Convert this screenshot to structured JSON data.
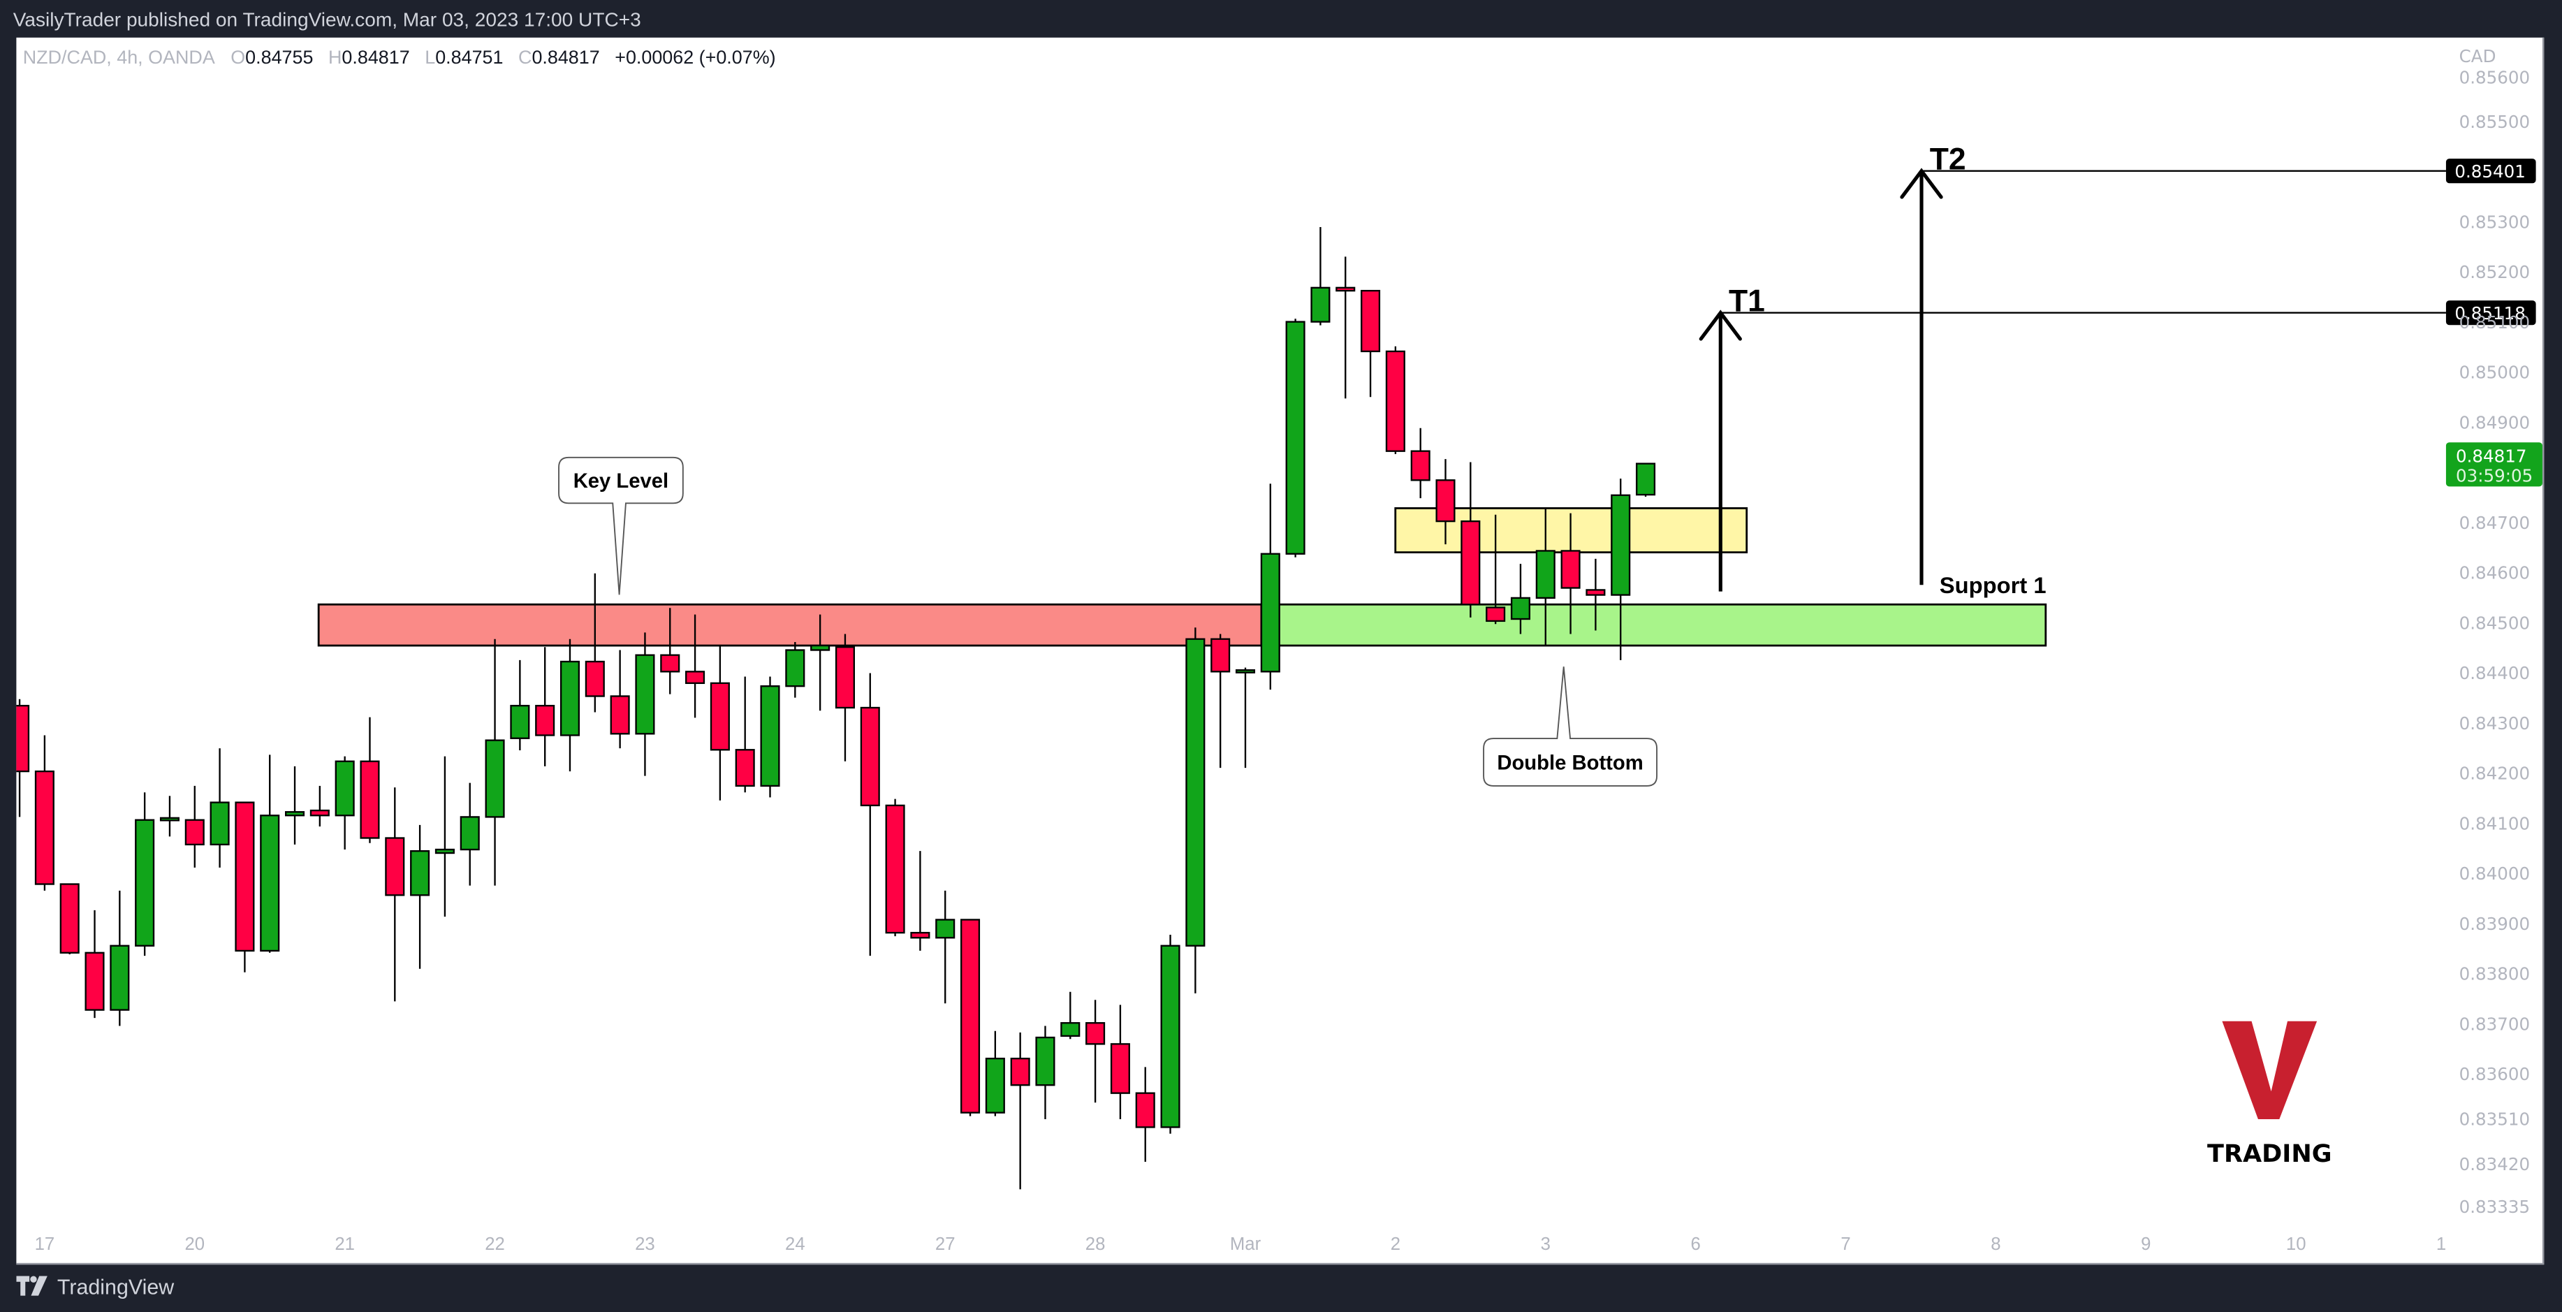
{
  "header": {
    "published": "VasilyTrader published on TradingView.com, Mar 03, 2023 17:00 UTC+3"
  },
  "legend": {
    "symbol": "NZD/CAD, 4h, OANDA",
    "o_label": "O",
    "o": "0.84755",
    "h_label": "H",
    "h": "0.84817",
    "l_label": "L",
    "l": "0.84751",
    "c_label": "C",
    "c": "0.84817",
    "change": "+0.00062 (+0.07%)"
  },
  "price_axis": {
    "currency": "CAD",
    "ticks": [
      "0.85600",
      "0.85500",
      "0.85300",
      "0.85200",
      "0.85100",
      "0.85000",
      "0.84900",
      "0.84800",
      "0.84700",
      "0.84600",
      "0.84500",
      "0.84400",
      "0.84300",
      "0.84200",
      "0.84100",
      "0.84000",
      "0.83900",
      "0.83800",
      "0.83700",
      "0.83600",
      "0.83510",
      "0.83420",
      "0.83335"
    ],
    "t2_label": "0.85401",
    "t1_label": "0.85118",
    "current_price": "0.84817",
    "countdown": "03:59:05"
  },
  "time_axis": {
    "ticks": [
      "17",
      "20",
      "21",
      "22",
      "23",
      "24",
      "27",
      "28",
      "Mar",
      "2",
      "3",
      "6",
      "7",
      "8",
      "9",
      "10",
      "1"
    ]
  },
  "annotations": {
    "key_level": "Key Level",
    "double_bottom": "Double Bottom",
    "support": "Support 1",
    "t1": "T1",
    "t2": "T2"
  },
  "watermark": {
    "letter": "V",
    "text": "TRADING"
  },
  "footer": {
    "brand": "TradingView"
  },
  "colors": {
    "up": "#11a51a",
    "down": "#ff0044",
    "resistance_zone": "#fa8a87",
    "support_zone": "#a8f48a",
    "entry_zone": "#fff59d",
    "logo_red": "#c8202f",
    "current_price_bg": "#13a41c"
  },
  "chart_data": {
    "type": "candlestick",
    "symbol": "NZD/CAD",
    "interval": "4h",
    "ylim": [
      0.8333,
      0.856
    ],
    "fields": [
      "open",
      "high",
      "low",
      "close"
    ],
    "candles": [
      [
        0.84334,
        0.84347,
        0.84112,
        0.84203
      ],
      [
        0.84203,
        0.84275,
        0.83965,
        0.83978
      ],
      [
        0.83978,
        0.83978,
        0.83838,
        0.83841
      ],
      [
        0.83841,
        0.83926,
        0.83711,
        0.83727
      ],
      [
        0.83727,
        0.83965,
        0.83695,
        0.83855
      ],
      [
        0.83855,
        0.84161,
        0.83835,
        0.84106
      ],
      [
        0.84106,
        0.84154,
        0.84073,
        0.8411
      ],
      [
        0.84106,
        0.84174,
        0.84011,
        0.84057
      ],
      [
        0.84057,
        0.84249,
        0.84011,
        0.84141
      ],
      [
        0.84141,
        0.84141,
        0.83802,
        0.83845
      ],
      [
        0.83845,
        0.84236,
        0.83841,
        0.84115
      ],
      [
        0.84115,
        0.84213,
        0.84057,
        0.84122
      ],
      [
        0.84125,
        0.84174,
        0.84093,
        0.84115
      ],
      [
        0.84115,
        0.84233,
        0.84047,
        0.84223
      ],
      [
        0.84223,
        0.84311,
        0.8406,
        0.8407
      ],
      [
        0.8407,
        0.84171,
        0.83744,
        0.83956
      ],
      [
        0.83956,
        0.84096,
        0.83809,
        0.84044
      ],
      [
        0.8404,
        0.84233,
        0.83913,
        0.84047
      ],
      [
        0.84047,
        0.8418,
        0.83975,
        0.84112
      ],
      [
        0.84112,
        0.84467,
        0.83975,
        0.84265
      ],
      [
        0.84269,
        0.84425,
        0.84245,
        0.84334
      ],
      [
        0.84334,
        0.84451,
        0.84213,
        0.84275
      ],
      [
        0.84275,
        0.84467,
        0.84203,
        0.84422
      ],
      [
        0.84422,
        0.84598,
        0.84321,
        0.84353
      ],
      [
        0.84353,
        0.84445,
        0.84249,
        0.84278
      ],
      [
        0.84278,
        0.8448,
        0.84194,
        0.84435
      ],
      [
        0.84435,
        0.84529,
        0.84357,
        0.84402
      ],
      [
        0.84402,
        0.84516,
        0.8431,
        0.84379
      ],
      [
        0.84379,
        0.84454,
        0.84145,
        0.84246
      ],
      [
        0.84246,
        0.84392,
        0.84161,
        0.84174
      ],
      [
        0.84174,
        0.84392,
        0.84151,
        0.84373
      ],
      [
        0.84373,
        0.84461,
        0.8435,
        0.84445
      ],
      [
        0.84445,
        0.84516,
        0.84324,
        0.84454
      ],
      [
        0.84451,
        0.84477,
        0.84223,
        0.8433
      ],
      [
        0.8433,
        0.84399,
        0.83835,
        0.84135
      ],
      [
        0.84135,
        0.84148,
        0.83874,
        0.83881
      ],
      [
        0.83881,
        0.84044,
        0.83845,
        0.83871
      ],
      [
        0.83871,
        0.83965,
        0.8374,
        0.83907
      ],
      [
        0.83907,
        0.83907,
        0.83515,
        0.83522
      ],
      [
        0.83522,
        0.83685,
        0.83515,
        0.8363
      ],
      [
        0.8363,
        0.83682,
        0.83369,
        0.83577
      ],
      [
        0.83577,
        0.83695,
        0.83509,
        0.83672
      ],
      [
        0.83675,
        0.83763,
        0.83669,
        0.83701
      ],
      [
        0.83701,
        0.83747,
        0.83542,
        0.83659
      ],
      [
        0.83659,
        0.83737,
        0.83509,
        0.83561
      ],
      [
        0.83561,
        0.83613,
        0.83424,
        0.83493
      ],
      [
        0.83493,
        0.83877,
        0.8348,
        0.83855
      ],
      [
        0.83855,
        0.8449,
        0.8376,
        0.84467
      ],
      [
        0.84467,
        0.84477,
        0.8421,
        0.84402
      ],
      [
        0.84402,
        0.8441,
        0.8421,
        0.84405
      ],
      [
        0.84402,
        0.84777,
        0.84366,
        0.84637
      ],
      [
        0.84637,
        0.85106,
        0.8463,
        0.851
      ],
      [
        0.851,
        0.85289,
        0.85093,
        0.85168
      ],
      [
        0.85168,
        0.8523,
        0.84947,
        0.85162
      ],
      [
        0.85162,
        0.85162,
        0.8495,
        0.85041
      ],
      [
        0.85041,
        0.85051,
        0.84836,
        0.84842
      ],
      [
        0.84842,
        0.84888,
        0.84748,
        0.84784
      ],
      [
        0.84784,
        0.84826,
        0.84656,
        0.84702
      ],
      [
        0.84702,
        0.8482,
        0.8451,
        0.84536
      ],
      [
        0.8453,
        0.84715,
        0.84497,
        0.84503
      ],
      [
        0.84507,
        0.84617,
        0.84477,
        0.84549
      ],
      [
        0.84549,
        0.84728,
        0.84454,
        0.84643
      ],
      [
        0.84643,
        0.84718,
        0.84477,
        0.84569
      ],
      [
        0.84565,
        0.84627,
        0.84484,
        0.84555
      ],
      [
        0.84555,
        0.84787,
        0.84425,
        0.84754
      ],
      [
        0.84755,
        0.84817,
        0.84751,
        0.84817
      ]
    ],
    "levels": {
      "t1": 0.85118,
      "t2": 0.85401,
      "current": 0.84817
    },
    "grid": false
  }
}
